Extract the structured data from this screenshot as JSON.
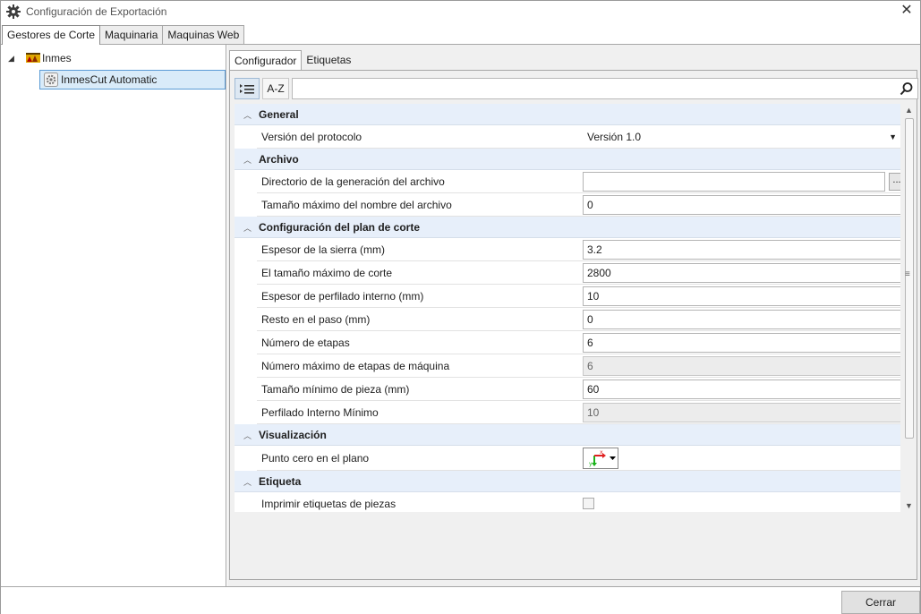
{
  "window": {
    "title": "Configuración de Exportación"
  },
  "outer_tabs": [
    {
      "label": "Gestores de Corte",
      "active": true
    },
    {
      "label": "Maquinaria",
      "active": false
    },
    {
      "label": "Maquinas Web",
      "active": false
    }
  ],
  "tree": {
    "root": "Inmes",
    "child": "InmesCut Automatic"
  },
  "inner_tabs": [
    {
      "label": "Configurador",
      "active": true
    },
    {
      "label": "Etiquetas",
      "active": false
    }
  ],
  "toolbar": {
    "az_label": "A-Z",
    "search_value": ""
  },
  "grid": {
    "general": {
      "title": "General",
      "version_label": "Versión del protocolo",
      "version_value": "Versión 1.0"
    },
    "archivo": {
      "title": "Archivo",
      "dir_label": "Directorio de la generación del archivo",
      "dir_value": "",
      "dots_label": "...",
      "maxname_label": "Tamaño máximo del nombre del archivo",
      "maxname_value": "0"
    },
    "plan": {
      "title": "Configuración del plan de corte",
      "rows": [
        {
          "label": "Espesor de la sierra (mm)",
          "value": "3.2",
          "readonly": false
        },
        {
          "label": "El tamaño máximo de corte",
          "value": "2800",
          "readonly": false
        },
        {
          "label": "Espesor de perfilado interno (mm)",
          "value": "10",
          "readonly": false
        },
        {
          "label": "Resto en el paso (mm)",
          "value": "0",
          "readonly": false
        },
        {
          "label": "Número de etapas",
          "value": "6",
          "readonly": false
        },
        {
          "label": "Número máximo de etapas de máquina",
          "value": "6",
          "readonly": true
        },
        {
          "label": "Tamaño mínimo de pieza (mm)",
          "value": "60",
          "readonly": false
        },
        {
          "label": "Perfilado Interno Mínimo",
          "value": "10",
          "readonly": true
        }
      ]
    },
    "visualizacion": {
      "title": "Visualización",
      "zero_label": "Punto cero en el plano",
      "axis_x": "x",
      "axis_y": "y"
    },
    "etiqueta": {
      "title": "Etiqueta",
      "print_label": "Imprimir etiquetas de piezas",
      "print_checked": false
    }
  },
  "footer": {
    "close_label": "Cerrar"
  }
}
